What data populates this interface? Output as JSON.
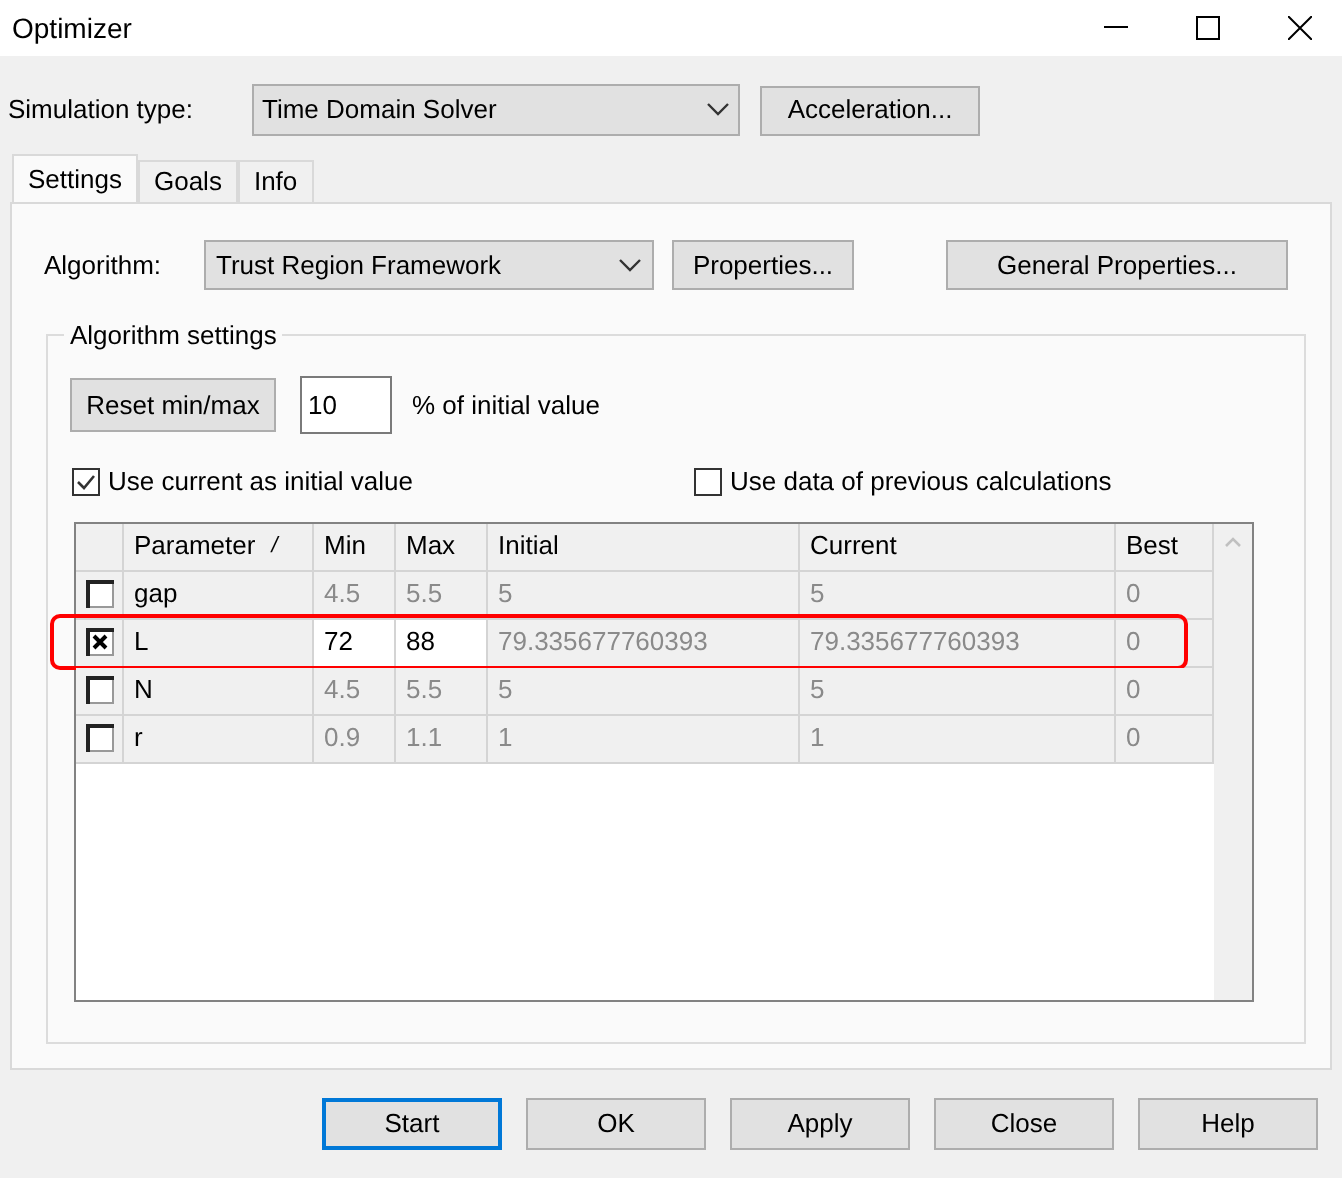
{
  "window": {
    "title": "Optimizer"
  },
  "simulation_type": {
    "label": "Simulation type:",
    "value": "Time Domain Solver",
    "button": "Acceleration..."
  },
  "tabs": [
    {
      "label": "Settings",
      "selected": true
    },
    {
      "label": "Goals",
      "selected": false
    },
    {
      "label": "Info",
      "selected": false
    }
  ],
  "algorithm": {
    "label": "Algorithm:",
    "value": "Trust Region Framework",
    "properties_button": "Properties...",
    "general_button": "General Properties..."
  },
  "algorithm_settings": {
    "title": "Algorithm settings",
    "reset_button": "Reset min/max",
    "percent_value": "10",
    "percent_label": "% of initial value",
    "options": [
      {
        "label": "Use current as initial value",
        "checked": true
      },
      {
        "label": "Use data of previous calculations",
        "checked": false
      }
    ]
  },
  "table": {
    "columns": [
      "Parameter",
      "Min",
      "Max",
      "Initial",
      "Current",
      "Best"
    ],
    "sort_mark": "/",
    "rows": [
      {
        "checked": false,
        "highlighted": false,
        "cells": [
          "gap",
          "4.5",
          "5.5",
          "5",
          "5",
          "0"
        ]
      },
      {
        "checked": true,
        "highlighted": true,
        "cells": [
          "L",
          "72",
          "88",
          "79.335677760393",
          "79.335677760393",
          "0"
        ]
      },
      {
        "checked": false,
        "highlighted": false,
        "cells": [
          "N",
          "4.5",
          "5.5",
          "5",
          "5",
          "0"
        ]
      },
      {
        "checked": false,
        "highlighted": false,
        "cells": [
          "r",
          "0.9",
          "1.1",
          "1",
          "1",
          "0"
        ]
      }
    ]
  },
  "buttons": [
    {
      "label": "Start",
      "default": true
    },
    {
      "label": "OK",
      "default": false
    },
    {
      "label": "Apply",
      "default": false
    },
    {
      "label": "Close",
      "default": false
    },
    {
      "label": "Help",
      "default": false
    }
  ]
}
